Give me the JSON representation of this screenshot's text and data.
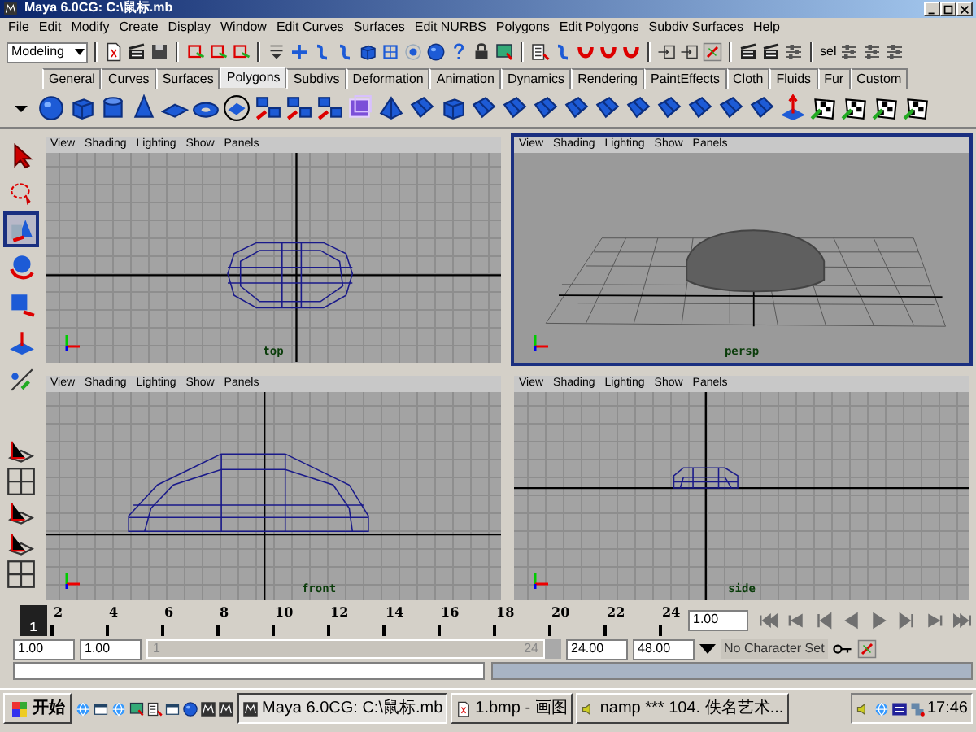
{
  "window": {
    "title": "Maya 6.0CG: C:\\鼠标.mb"
  },
  "menu_bar": [
    "File",
    "Edit",
    "Modify",
    "Create",
    "Display",
    "Window",
    "Edit Curves",
    "Surfaces",
    "Edit NURBS",
    "Polygons",
    "Edit Polygons",
    "Subdiv Surfaces",
    "Help"
  ],
  "status_line": {
    "menu_set": "Modeling",
    "selection_label": "sel"
  },
  "shelf_tabs": [
    {
      "label": "General",
      "selected": false
    },
    {
      "label": "Curves",
      "selected": false
    },
    {
      "label": "Surfaces",
      "selected": false
    },
    {
      "label": "Polygons",
      "selected": true
    },
    {
      "label": "Subdivs",
      "selected": false
    },
    {
      "label": "Deformation",
      "selected": false
    },
    {
      "label": "Animation",
      "selected": false
    },
    {
      "label": "Dynamics",
      "selected": false
    },
    {
      "label": "Rendering",
      "selected": false
    },
    {
      "label": "PaintEffects",
      "selected": false
    },
    {
      "label": "Cloth",
      "selected": false
    },
    {
      "label": "Fluids",
      "selected": false
    },
    {
      "label": "Fur",
      "selected": false
    },
    {
      "label": "Custom",
      "selected": false
    }
  ],
  "toolbox": [
    {
      "selected": false
    },
    {
      "selected": false
    },
    {
      "selected": true
    },
    {
      "selected": false
    },
    {
      "selected": false
    },
    {
      "selected": false
    },
    {
      "selected": false
    }
  ],
  "viewports": [
    {
      "menus": [
        "View",
        "Shading",
        "Lighting",
        "Show",
        "Panels"
      ],
      "camera": "top",
      "selected": false
    },
    {
      "menus": [
        "View",
        "Shading",
        "Lighting",
        "Show",
        "Panels"
      ],
      "camera": "persp",
      "selected": true
    },
    {
      "menus": [
        "View",
        "Shading",
        "Lighting",
        "Show",
        "Panels"
      ],
      "camera": "front",
      "selected": false
    },
    {
      "menus": [
        "View",
        "Shading",
        "Lighting",
        "Show",
        "Panels"
      ],
      "camera": "side",
      "selected": false
    }
  ],
  "time_slider": {
    "current_frame": "1",
    "ticks": [
      "2",
      "4",
      "6",
      "8",
      "10",
      "12",
      "14",
      "16",
      "18",
      "20",
      "22",
      "24"
    ],
    "current_time": "1.00"
  },
  "range_slider": {
    "start_time": "1.00",
    "range_start": "1.00",
    "handle_start": "1",
    "handle_end": "24",
    "range_end": "24.00",
    "end_time": "48.00",
    "character_set": "No Character Set"
  },
  "taskbar": {
    "start": "开始",
    "tasks": [
      {
        "label": "Maya 6.0CG: C:\\鼠标.mb",
        "selected": true
      },
      {
        "label": "1.bmp - 画图",
        "selected": false
      },
      {
        "label": "namp *** 104. 佚名艺术...",
        "selected": false
      }
    ],
    "clock": "17:46"
  }
}
